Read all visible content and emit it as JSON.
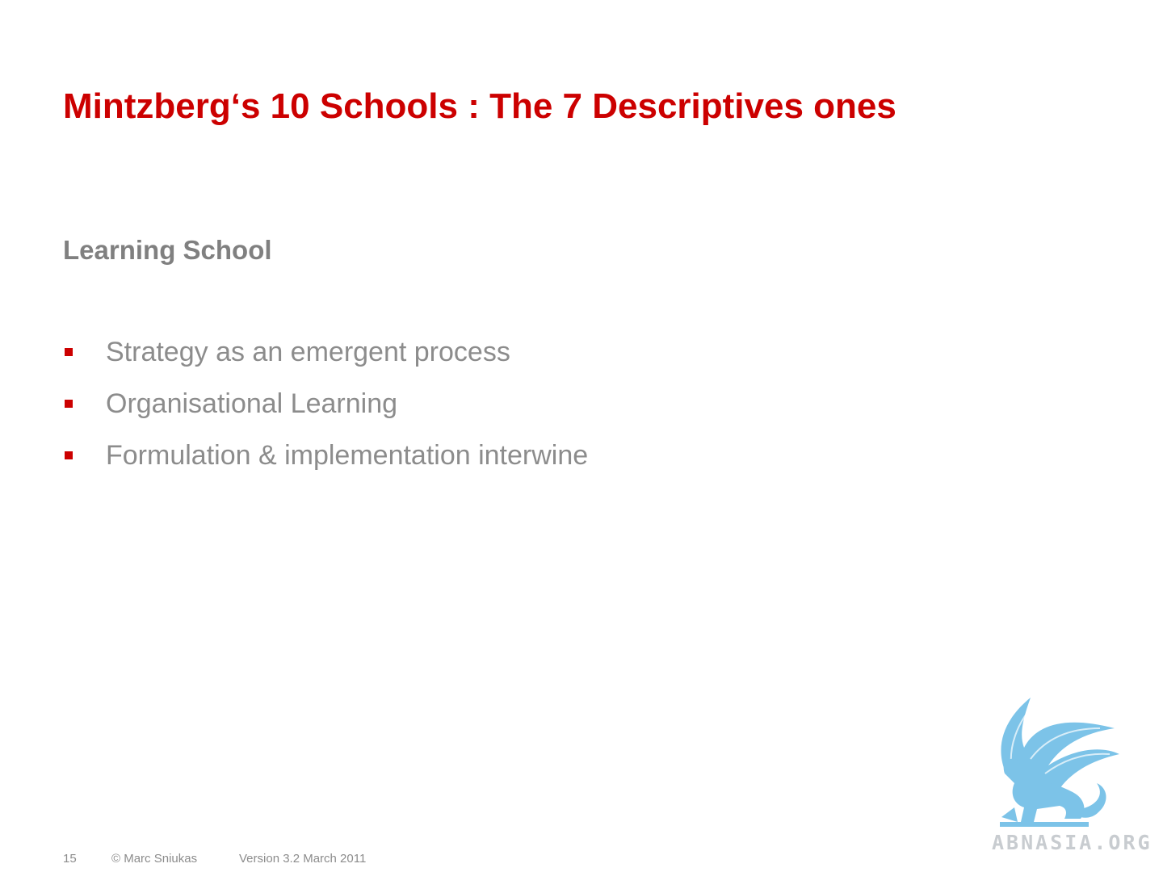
{
  "slide": {
    "title": "Mintzberg‘s 10 Schools : The 7 Descriptives ones",
    "subtitle": "Learning School",
    "bullets": [
      "Strategy as an emergent process",
      "Organisational Learning",
      "Formulation & implementation interwine"
    ]
  },
  "footer": {
    "page_number": "15",
    "copyright": "© Marc Sniukas",
    "version": "Version 3.2 March 2011"
  },
  "watermark": {
    "text": "ABNASIA.ORG",
    "icon": "griffin-icon"
  },
  "colors": {
    "title": "#cc0000",
    "bullet_marker": "#cc0000",
    "body_text": "#8c8c8c",
    "logo_blue": "#7cc3e8",
    "logo_text": "#c8ccd0"
  }
}
